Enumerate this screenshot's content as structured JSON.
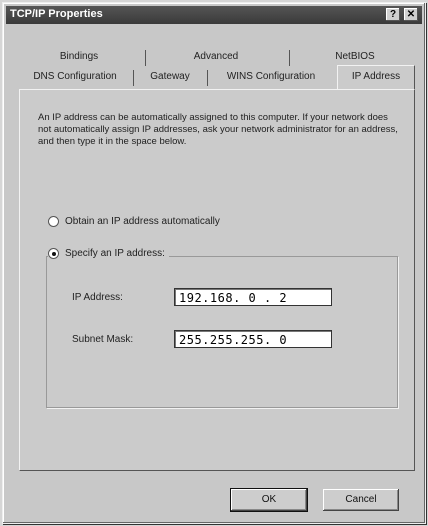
{
  "window": {
    "title": "TCP/IP Properties"
  },
  "titlebar_buttons": {
    "help": "?",
    "close": "✕"
  },
  "tabs_row1": [
    "Bindings",
    "Advanced",
    "NetBIOS"
  ],
  "tabs_row2": [
    "DNS Configuration",
    "Gateway",
    "WINS Configuration",
    "IP Address"
  ],
  "active_tab": "IP Address",
  "description": "An IP address can be automatically assigned to this computer. If your network does not automatically assign IP addresses, ask your network administrator for an address, and then type it in the space below.",
  "options": {
    "obtain_label": "Obtain an IP address automatically",
    "specify_label": "Specify an IP address:",
    "selected": "specify"
  },
  "fields": {
    "ip_label": "IP Address:",
    "ip_value": "192.168. 0 . 2",
    "mask_label": "Subnet Mask:",
    "mask_value": "255.255.255. 0"
  },
  "buttons": {
    "ok": "OK",
    "cancel": "Cancel"
  }
}
